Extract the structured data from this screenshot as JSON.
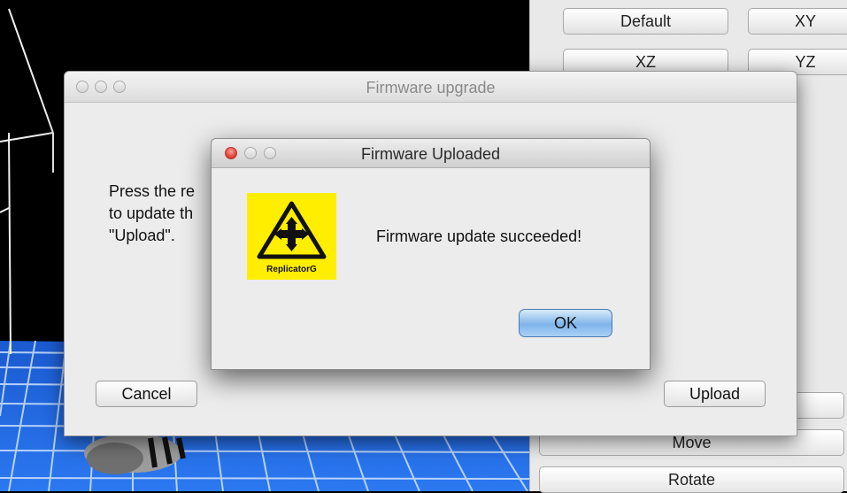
{
  "right_panel": {
    "view_buttons": [
      "Default",
      "XY",
      "XZ",
      "YZ"
    ],
    "move_label": "Move",
    "rotate_label": "Rotate"
  },
  "firmware_window": {
    "title": "Firmware upgrade",
    "instructions_line1": "Press the re                                                           d\" button",
    "instructions_line2": "to update th                                                           re you click",
    "instructions_line3": "\"Upload\".",
    "cancel_label": "Cancel",
    "upload_label": "Upload"
  },
  "dialog": {
    "title": "Firmware Uploaded",
    "logo_text": "ReplicatorG",
    "message": "Firmware update succeeded!",
    "ok_label": "OK"
  },
  "colors": {
    "logo_yellow": "#ffee00",
    "grid_blue": "#1e5fd6",
    "ok_blue": "#7fb4ea"
  }
}
